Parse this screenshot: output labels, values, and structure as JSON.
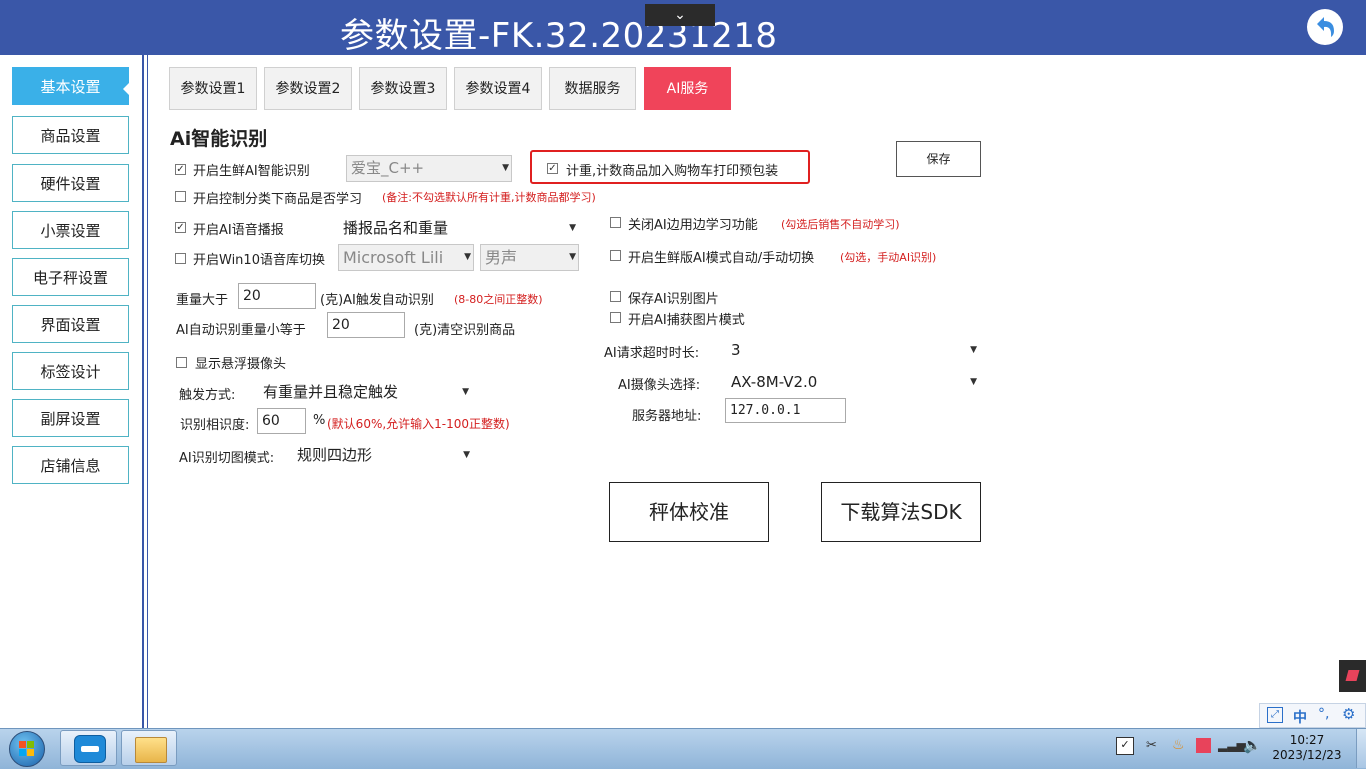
{
  "window": {
    "title": "参数设置-FK.32.20231218",
    "collapse_glyph": "⌄"
  },
  "sidebar": {
    "items": [
      {
        "label": "基本设置"
      },
      {
        "label": "商品设置"
      },
      {
        "label": "硬件设置"
      },
      {
        "label": "小票设置"
      },
      {
        "label": "电子秤设置"
      },
      {
        "label": "界面设置"
      },
      {
        "label": "标签设计"
      },
      {
        "label": "副屏设置"
      },
      {
        "label": "店铺信息"
      }
    ]
  },
  "tabs": [
    {
      "label": "参数设置1"
    },
    {
      "label": "参数设置2"
    },
    {
      "label": "参数设置3"
    },
    {
      "label": "参数设置4"
    },
    {
      "label": "数据服务"
    },
    {
      "label": "AI服务"
    }
  ],
  "section": {
    "title": "Ai智能识别"
  },
  "settings": {
    "fresh_ai": {
      "label": "开启生鲜AI智能识别",
      "checked": true,
      "select_value": "爱宝_C++"
    },
    "category_learning": {
      "label": "开启控制分类下商品是否学习",
      "checked": false,
      "note": "(备注:不勾选默认所有计重,计数商品都学习)"
    },
    "voice": {
      "label": "开启AI语音播报",
      "checked": true,
      "select_value": "播报品名和重量"
    },
    "win10_voice": {
      "label": "开启Win10语音库切换",
      "checked": false,
      "voice_value": "Microsoft Lili",
      "gender_value": "男声"
    },
    "weight_gt": {
      "prefix": "重量大于",
      "value": "20",
      "suffix": "(克)AI触发自动识别",
      "note": "(8-80之间正整数)"
    },
    "weight_lt": {
      "prefix": "AI自动识别重量小等于",
      "value": "20",
      "suffix": "(克)清空识别商品"
    },
    "floating_camera": {
      "label": "显示悬浮摄像头",
      "checked": false
    },
    "trigger": {
      "label": "触发方式:",
      "value": "有重量并且稳定触发"
    },
    "similarity": {
      "label": "识别相识度:",
      "value": "60",
      "unit": "%",
      "note": "(默认60%,允许输入1-100正整数)"
    },
    "crop_mode": {
      "label": "AI识别切图模式:",
      "value": "规则四边形"
    },
    "preprint": {
      "label": "计重,计数商品加入购物车打印预包装",
      "checked": true
    },
    "save_button": "保存",
    "disable_learning": {
      "label": "关闭AI边用边学习功能",
      "checked": false,
      "note": "(勾选后销售不自动学习)"
    },
    "fresh_mode_switch": {
      "label": "开启生鲜版AI模式自动/手动切换",
      "checked": false,
      "note": "(勾选，手动AI识别)"
    },
    "save_images": {
      "label": "保存AI识别图片",
      "checked": false
    },
    "capture_mode": {
      "label": "开启AI捕获图片模式",
      "checked": false
    },
    "timeout": {
      "label": "AI请求超时时长:",
      "value": "3"
    },
    "camera": {
      "label": "AI摄像头选择:",
      "value": "AX-8M-V2.0"
    },
    "server": {
      "label": "服务器地址:",
      "value": "127.0.0.1"
    },
    "calibrate_button": "秤体校准",
    "download_button": "下载算法SDK"
  },
  "tray": {
    "ime_label": "中",
    "time": "10:27",
    "date": "2023/12/23"
  },
  "colors": {
    "header": "#3a57a8",
    "active_tab": "#f0445a",
    "active_sidebar": "#3ab0e8",
    "highlight_box": "#e02020"
  }
}
